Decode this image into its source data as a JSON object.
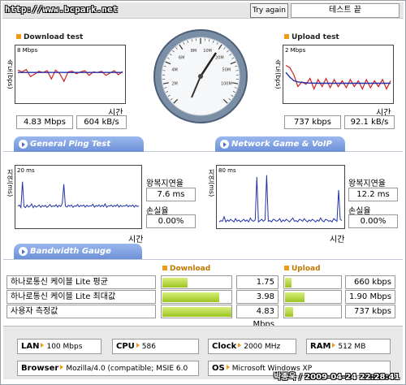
{
  "header": {
    "url": "http://www.bcpark.net",
    "try_again_label": "Try again",
    "status": "테스트 끝"
  },
  "download": {
    "title": "Download test",
    "ylabel": "속도(bps)",
    "xlabel": "시간",
    "scale": "8 Mbps",
    "speed_mbps": "4.83 Mbps",
    "speed_kbs": "604 kB/s",
    "chart_data": {
      "type": "line",
      "series": [
        {
          "color": "#cc2222",
          "values": [
            5.2,
            4.9,
            5.3,
            4.1,
            4.5,
            5.0,
            4.8,
            5.1,
            3.7,
            5.2,
            4.6,
            3.3,
            4.9,
            5.0,
            4.6,
            4.9,
            5.1,
            4.3,
            4.9,
            4.8,
            5.0,
            4.3,
            4.7,
            5.1,
            4.4,
            5.0
          ]
        },
        {
          "color": "#2233aa",
          "values": [
            4.8,
            4.8,
            4.8,
            4.8,
            4.8,
            4.8,
            4.8,
            4.8,
            4.8,
            4.8,
            4.8,
            4.8,
            4.8,
            4.8,
            4.8,
            4.8,
            4.8,
            4.8,
            4.8,
            4.8,
            4.8,
            4.8,
            4.8,
            4.8,
            4.8,
            4.8
          ]
        }
      ],
      "ylim": [
        0,
        8
      ]
    }
  },
  "upload": {
    "title": "Upload test",
    "ylabel": "속도(bps)",
    "xlabel": "시간",
    "scale": "2 Mbps",
    "speed_kbps": "737 kbps",
    "speed_kbs": "92.1 kB/s",
    "chart_data": {
      "type": "line",
      "series": [
        {
          "color": "#cc2222",
          "values": [
            1.5,
            1.4,
            1.1,
            0.6,
            0.8,
            0.7,
            0.95,
            0.5,
            0.9,
            0.6,
            0.95,
            0.55,
            0.9,
            0.6,
            0.85,
            0.55,
            0.9,
            0.6,
            0.85,
            0.5,
            0.9,
            0.55,
            0.85,
            0.6,
            0.9,
            0.5,
            0.85
          ]
        },
        {
          "color": "#2233aa",
          "values": [
            1.2,
            1.0,
            0.85,
            0.8,
            0.78,
            0.76,
            0.75,
            0.75,
            0.74,
            0.74,
            0.74,
            0.74,
            0.74,
            0.74,
            0.74,
            0.74,
            0.74,
            0.74,
            0.74,
            0.74,
            0.74,
            0.74,
            0.74,
            0.74,
            0.74,
            0.74,
            0.74
          ]
        }
      ],
      "ylim": [
        0,
        2
      ]
    }
  },
  "speedometer": {
    "ticks": [
      "2M",
      "4M",
      "6M",
      "8M",
      "10M",
      "20M",
      "50M",
      "100M"
    ]
  },
  "ping": {
    "tab": "General Ping Test",
    "ylabel": "지연(ms)",
    "xlabel": "시간",
    "scale": "20 ms",
    "rtt_label": "왕복지연율",
    "rtt": "7.6 ms",
    "loss_label": "손실율",
    "loss": "0.00%",
    "chart_data": {
      "type": "line",
      "color": "#2233aa",
      "ylim": [
        0,
        20
      ],
      "values": [
        7.5,
        8,
        7,
        17,
        7.5,
        7,
        8,
        7.2,
        7.6,
        8.4,
        7,
        7.8,
        7.2,
        7.6,
        8,
        7.1,
        7.8,
        7.4,
        7.9,
        7.1,
        7.6,
        8.2,
        7.3,
        7.7,
        7.5,
        8.1,
        7.2,
        7.9,
        7.4,
        8.6,
        16,
        7.6,
        7.2,
        7.9,
        7.5,
        8,
        7.1,
        7.7,
        7.5,
        8.2,
        7.3,
        7.8,
        7.6,
        8,
        7.2,
        7.9,
        7.4,
        7.7,
        7.6,
        8.3,
        7.2,
        7.8,
        7.5,
        8.1,
        7.3,
        7.9,
        7.4,
        8.4,
        7.1,
        7.7,
        7.6,
        8,
        7.3,
        7.8,
        7.5,
        8.2,
        7.2,
        7.9,
        7.4,
        7.7,
        7.6,
        8.1,
        7.3,
        7.8,
        7.5,
        8,
        7.2,
        7.9,
        7.4,
        7.7
      ]
    }
  },
  "game": {
    "tab": "Network Game & VoIP Test",
    "ylabel": "지연(ms)",
    "xlabel": "시간",
    "scale": "80 ms",
    "rtt_label": "왕복지연율",
    "rtt": "12.2 ms",
    "loss_label": "손실율",
    "loss": "0.00%",
    "chart_data": {
      "type": "line",
      "color": "#2233aa",
      "ylim": [
        0,
        80
      ],
      "values": [
        6,
        8,
        7,
        14,
        6,
        9,
        7,
        10,
        8,
        6,
        11,
        7,
        9,
        6,
        8,
        10,
        7,
        9,
        6,
        12,
        8,
        7,
        9,
        75,
        6,
        8,
        10,
        7,
        9,
        78,
        7,
        8,
        6,
        10,
        9,
        7,
        8,
        11,
        6,
        9,
        7,
        10,
        8,
        6,
        9,
        12,
        7,
        8,
        6,
        10,
        9,
        7,
        11,
        8,
        6,
        9,
        7,
        10,
        8,
        6,
        9,
        7,
        12,
        8,
        6,
        10,
        9,
        7,
        8,
        6,
        11,
        9,
        7,
        55,
        10,
        8
      ]
    }
  },
  "bandwidth": {
    "tab": "Bandwidth Gauge",
    "download_label": "Download",
    "upload_label": "Upload",
    "rows": [
      {
        "label": "하나로통신 케이블 Lite 평균",
        "down": "1.75 Mbps",
        "down_frac": 0.36,
        "up": "660 kbps",
        "up_frac": 0.12
      },
      {
        "label": "하나로통신 케이블 Lite 최대값",
        "down": "3.98 Mbps",
        "down_frac": 0.82,
        "up": "1.90 Mbps",
        "up_frac": 0.35
      },
      {
        "label": "사용자 측정값",
        "down": "4.83 Mbps",
        "down_frac": 1.0,
        "up": "737 kbps",
        "up_frac": 0.14
      }
    ]
  },
  "system": {
    "lan_label": "LAN",
    "lan": "100 Mbps",
    "cpu_label": "CPU",
    "cpu": "586",
    "clock_label": "Clock",
    "clock": "2000 MHz",
    "ram_label": "RAM",
    "ram": "512 MB",
    "browser_label": "Browser",
    "browser": "Mozilla/4.0 (compatible; MSIE 6.0",
    "os_label": "OS",
    "os": "Microsoft Windows XP"
  },
  "footer": {
    "stamp": "박종욱 / 2009-04-24 22:28:41"
  }
}
